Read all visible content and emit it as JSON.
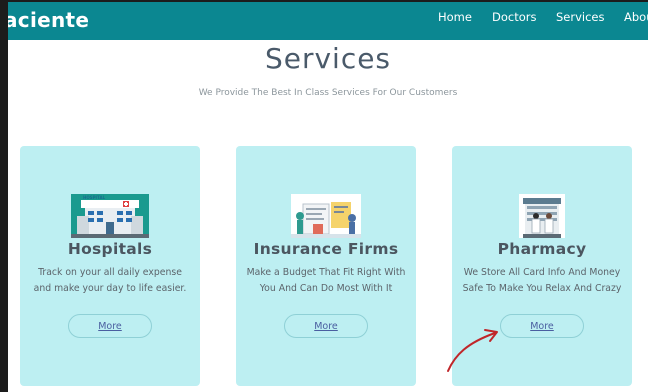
{
  "navbar": {
    "brand": "aciente",
    "links": [
      "Home",
      "Doctors",
      "Services",
      "About"
    ]
  },
  "services": {
    "title": "Services",
    "subtitle": "We Provide The Best In Class Services For Our Customers"
  },
  "cards": [
    {
      "title": "Hospitals",
      "description": "Track on your all daily expense and make your day to life easier.",
      "button": "More",
      "image_label": "HOSPITAL"
    },
    {
      "title": "Insurance Firms",
      "description": "Make a Budget That Fit Right With You And Can Do Most With It",
      "button": "More"
    },
    {
      "title": "Pharmacy",
      "description": "We Store All Card Info And Money Safe To Make You Relax And Crazy",
      "button": "More"
    }
  ],
  "colors": {
    "navbar": "#0b8791",
    "card": "#bdeff2",
    "title": "#4a5a6a",
    "arrow": "#c0262a"
  }
}
